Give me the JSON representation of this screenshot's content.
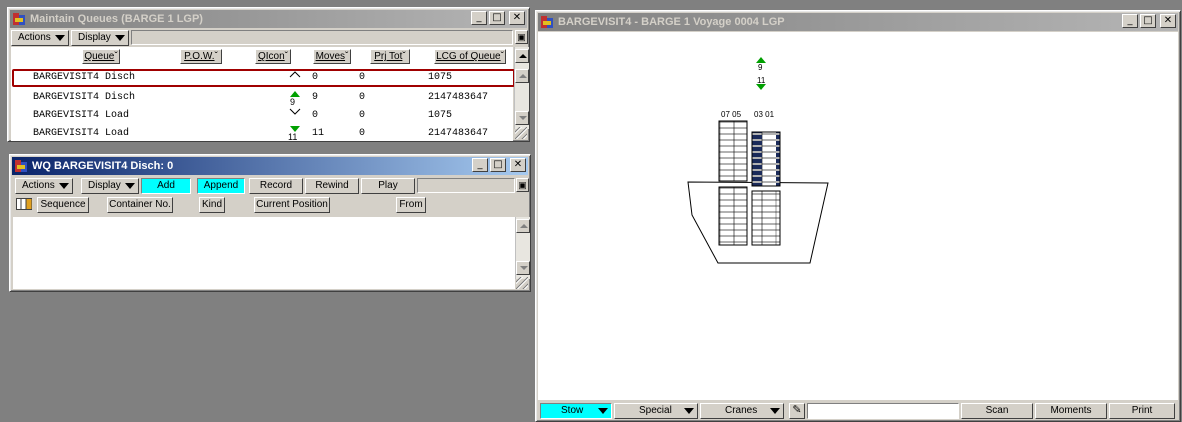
{
  "queues_window": {
    "title": "Maintain Queues (BARGE 1 LGP)",
    "actions_label": "Actions",
    "display_label": "Display",
    "columns": [
      "Queue",
      "P.O.W.",
      "QIcon",
      "Moves",
      "Prj Tot",
      "LCG of Queue"
    ],
    "rows": [
      {
        "queue": "BARGEVISIT4 Disch",
        "moves": "0",
        "prj_tot": "0",
        "lcg": "1075"
      },
      {
        "queue": "BARGEVISIT4 Disch",
        "qicon_label": "9",
        "moves": "9",
        "prj_tot": "0",
        "lcg": "2147483647"
      },
      {
        "queue": "BARGEVISIT4 Load",
        "moves": "0",
        "prj_tot": "0",
        "lcg": "1075"
      },
      {
        "queue": "BARGEVISIT4 Load",
        "qicon_label": "11",
        "moves": "11",
        "prj_tot": "0",
        "lcg": "2147483647"
      }
    ]
  },
  "wq_window": {
    "title": "WQ BARGEVISIT4 Disch:  0",
    "actions_label": "Actions",
    "display_label": "Display",
    "buttons": {
      "add": "Add",
      "append": "Append",
      "record": "Record",
      "rewind": "Rewind",
      "play": "Play"
    },
    "columns": [
      "Sequence",
      "Container No.",
      "Kind",
      "Current Position",
      "From"
    ]
  },
  "barge_window": {
    "title": "BARGEVISIT4 - BARGE 1  Voyage 0004 LGP",
    "queue_markers": {
      "discharge_count": "9",
      "load_count": "11"
    },
    "bay_labels": [
      "07 05",
      "03 01"
    ],
    "statusbar": {
      "stow": "Stow",
      "special": "Special",
      "cranes": "Cranes",
      "scan": "Scan",
      "moments": "Moments",
      "print": "Print"
    }
  },
  "colors": {
    "accent_cyan": "#00ffff",
    "marker_green": "#00a000",
    "selection_red": "#a00000",
    "titlebar_active": "#0a246a"
  }
}
